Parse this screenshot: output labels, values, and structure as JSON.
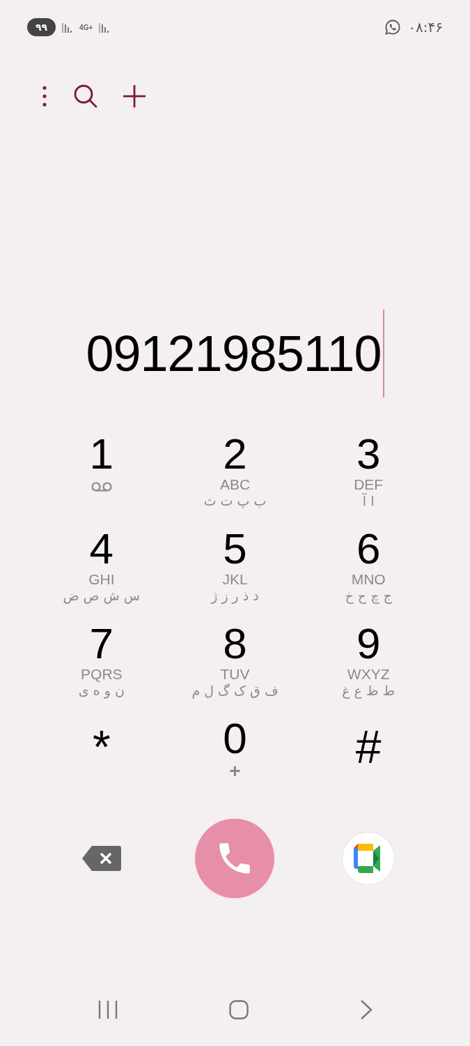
{
  "status_bar": {
    "battery": "۹۹",
    "network": "4G+",
    "time": "۰۸:۴۶"
  },
  "dialed_number": "09121985110",
  "keypad_rows": [
    {
      "left": {
        "kind": "voicemail",
        "digit": "1"
      },
      "middle": {
        "kind": "letters",
        "digit": "2",
        "latin": "ABC",
        "persian": "ب پ ت ث"
      },
      "right": {
        "kind": "letters",
        "digit": "3",
        "latin": "DEF",
        "persian": "ا آ"
      }
    },
    {
      "left": {
        "kind": "letters",
        "digit": "4",
        "latin": "GHI",
        "persian": "س ش ص ض"
      },
      "middle": {
        "kind": "letters",
        "digit": "5",
        "latin": "JKL",
        "persian": "د ذ ر ز ژ"
      },
      "right": {
        "kind": "letters",
        "digit": "6",
        "latin": "MNO",
        "persian": "ج چ ح خ"
      }
    },
    {
      "left": {
        "kind": "letters",
        "digit": "7",
        "latin": "PQRS",
        "persian": "ن و ه ی"
      },
      "middle": {
        "kind": "letters",
        "digit": "8",
        "latin": "TUV",
        "persian": "ف ق ک گ ل م"
      },
      "right": {
        "kind": "letters",
        "digit": "9",
        "latin": "WXYZ",
        "persian": "ط ظ ع غ"
      }
    },
    {
      "left": {
        "kind": "symbol",
        "digit": "*"
      },
      "middle": {
        "kind": "plus",
        "digit": "0",
        "sub": "+"
      },
      "right": {
        "kind": "symbol",
        "digit": "#"
      }
    }
  ]
}
